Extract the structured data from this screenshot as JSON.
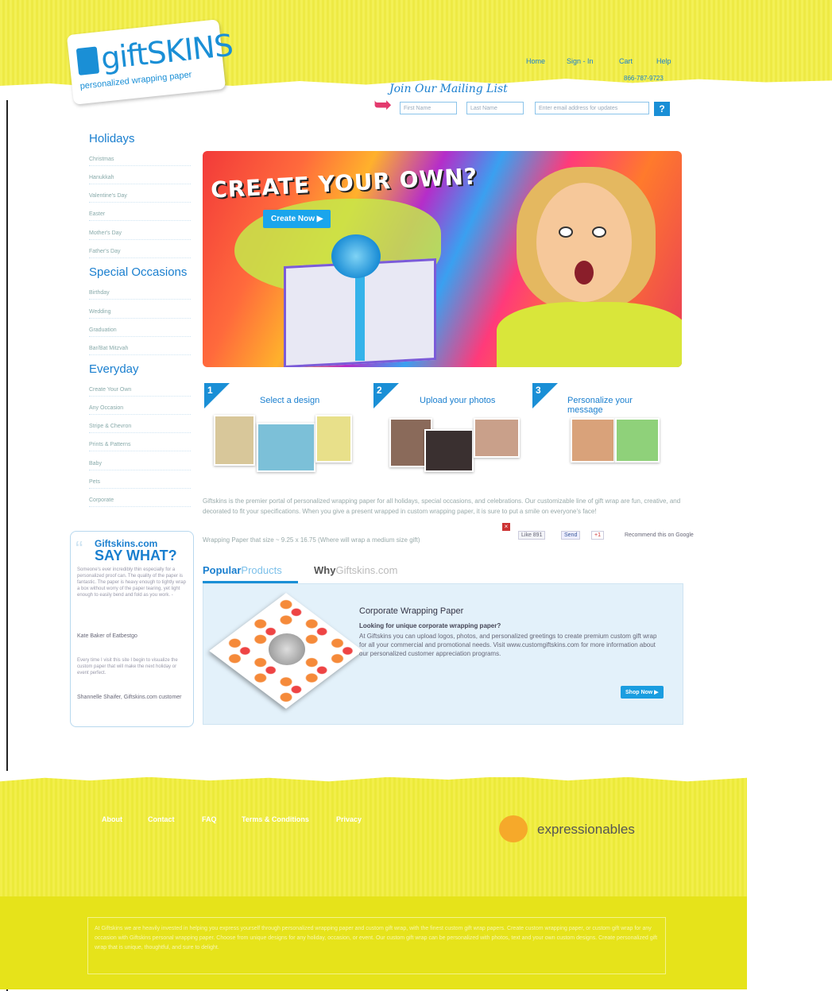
{
  "header": {
    "logo_text": "giftSKINS",
    "logo_tagline": "personalized wrapping paper",
    "nav": [
      "Home",
      "Sign - In",
      "Cart",
      "Help"
    ],
    "phone": "866-787-9723",
    "mailing_title": "Join Our Mailing List",
    "mailing": {
      "first_placeholder": "First Name",
      "last_placeholder": "Last Name",
      "email_placeholder": "Enter email address for updates",
      "submit_label": "?"
    }
  },
  "sidebar": {
    "categories": [
      {
        "title": "Holidays",
        "items": [
          "Christmas",
          "Hanukkah",
          "Valentine's Day",
          "Easter",
          "Mother's Day",
          "Father's Day"
        ]
      },
      {
        "title": "Special Occasions",
        "items": [
          "Birthday",
          "Wedding",
          "Graduation",
          "Bar/Bat Mitzvah"
        ]
      },
      {
        "title": "Everyday",
        "items": [
          "Create Your Own",
          "Any Occasion",
          "Stripe & Chevron",
          "Prints & Patterns",
          "Baby",
          "Pets",
          "Corporate"
        ]
      }
    ]
  },
  "hero": {
    "title": "CREATE YOUR OWN?",
    "cta": "Create Now ▶"
  },
  "steps": [
    {
      "num": "1",
      "label": "Select a design"
    },
    {
      "num": "2",
      "label": "Upload your photos"
    },
    {
      "num": "3",
      "label": "Personalize your message"
    }
  ],
  "description": "Giftskins is the premier portal of personalized wrapping paper for all holidays, special occasions, and celebrations. Our customizable line of gift wrap are fun, creative, and decorated to fit your specifications. When you give a present wrapped in custom wrapping paper, it is sure to put a smile on everyone's face!",
  "size_note": "Wrapping Paper that size ~ 9.25 x 16.75 (Where will wrap a medium size gift)",
  "social": {
    "like": "Like 891",
    "send": "Send",
    "plus": "+1",
    "recommend": "Recommend this on Google"
  },
  "testimonial": {
    "site": "Giftskins.com",
    "headline": "SAY WHAT?",
    "quote1": "Someone's ever incredibly thin especially for a personalized proof can. The quality of the paper is fantastic. The paper is heavy enough to tightly wrap a box without worry of the paper tearing, yet light enough to easily bend and fold as you work. -",
    "author1": "Kate Baker of Eatbestgo",
    "quote2": "Every time I visit this site I begin to visualize the custom paper that will make the next holiday or event perfect.",
    "author2": "Shannelle Shaifer, Giftskins.com customer"
  },
  "tabs": {
    "popular_a": "Popular",
    "popular_b": "Products",
    "why_a": "Why",
    "why_b": "Giftskins.com"
  },
  "product": {
    "title": "Corporate Wrapping Paper",
    "subtitle": "Looking for unique corporate wrapping paper?",
    "body": "At Giftskins you can upload logos, photos, and personalized greetings to create premium custom gift wrap for all your commercial and promotional needs. Visit www.customgiftskins.com for more information about our personalized customer appreciation programs.",
    "cta": "Shop Now ▶"
  },
  "footer": {
    "links": [
      "About",
      "Contact",
      "FAQ",
      "Terms & Conditions",
      "Privacy"
    ],
    "partner": "expressionables",
    "about_text": "At Giftskins we are heavily invested in helping you express yourself through personalized wrapping paper and custom gift wrap, with the finest custom gift wrap papers. Create custom wrapping paper, or custom gift wrap for any occasion with Giftskins personal wrapping paper. Choose from unique designs for any holiday, occasion, or event. Our custom gift wrap can be personalized with photos, text and your own custom designs. Create personalized gift wrap that is unique, thoughtful, and sure to delight."
  },
  "colors": {
    "brand_blue": "#1a8fd6",
    "yellow": "#f3f056",
    "panel_blue": "#e3f1fa"
  }
}
